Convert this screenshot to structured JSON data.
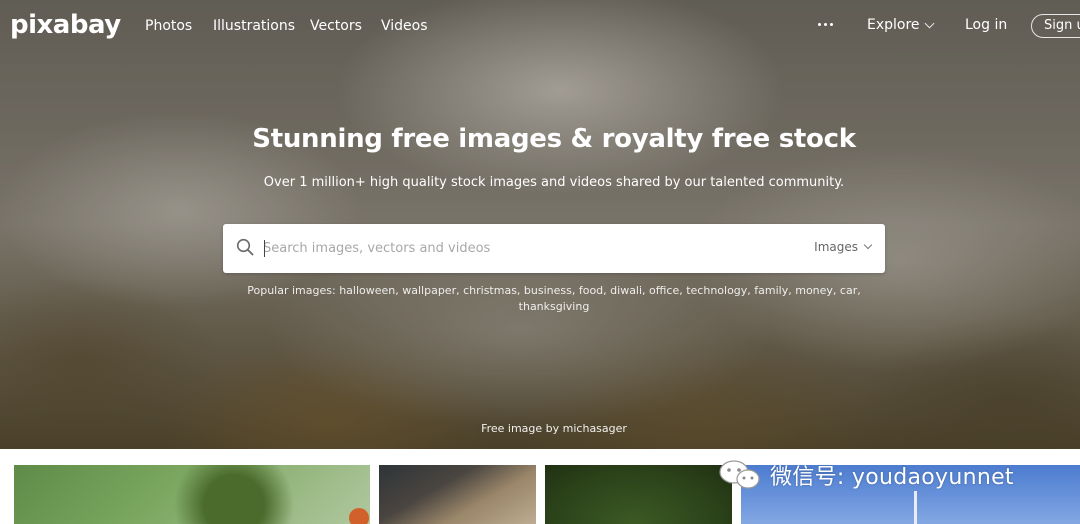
{
  "nav": {
    "logo": "pixabay",
    "links": [
      "Photos",
      "Illustrations",
      "Vectors",
      "Videos"
    ],
    "explore": "Explore",
    "login": "Log in",
    "signup": "Sign up"
  },
  "hero": {
    "headline": "Stunning free images & royalty free stock",
    "subline": "Over 1 million+ high quality stock images and videos shared by our talented community.",
    "credit": "Free image by michasager"
  },
  "search": {
    "placeholder": "Search images, vectors and videos",
    "type_selected": "Images"
  },
  "popular": {
    "label": "Popular images:",
    "tags": "halloween, wallpaper, christmas, business, food, diwali, office, technology, family, money, car, thanksgiving"
  },
  "watermark": {
    "text": "微信号: youdaoyunnet"
  }
}
